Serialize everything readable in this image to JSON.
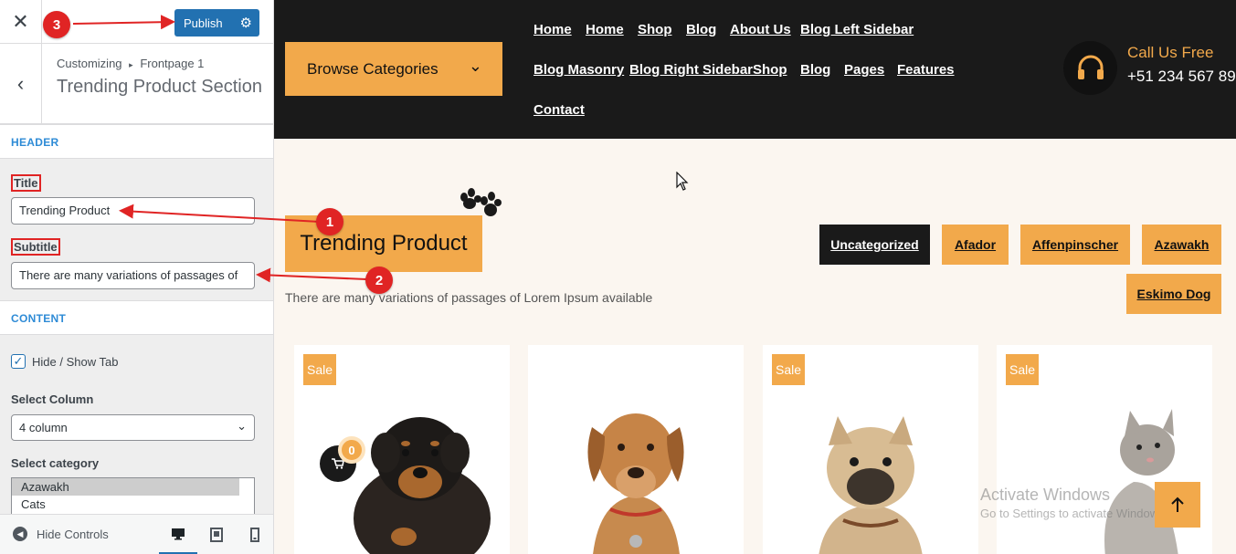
{
  "sidebar": {
    "publish_label": "Publish",
    "breadcrumb_root": "Customizing",
    "breadcrumb_sep": "▸",
    "breadcrumb_leaf": "Frontpage 1",
    "section_title": "Trending Product Section",
    "header_group": "HEADER",
    "title_label": "Title",
    "title_value": "Trending Product",
    "subtitle_label": "Subtitle",
    "subtitle_value": "There are many variations of passages of",
    "content_group": "CONTENT",
    "hide_show_tab": "Hide / Show Tab",
    "select_column_label": "Select Column",
    "select_column_value": "4 column",
    "select_category_label": "Select category",
    "category_options": [
      "Azawakh",
      "Cats"
    ],
    "hide_controls": "Hide Controls"
  },
  "preview": {
    "browse_categories": "Browse Categories",
    "nav": [
      "Home",
      "Home",
      "Shop",
      "Blog",
      "About Us",
      "Blog Left Sidebar",
      "Blog Masonry",
      "Blog Right Sidebar",
      "Shop",
      "Blog",
      "Pages",
      "Features",
      "Contact"
    ],
    "call_label": "Call Us Free",
    "call_number": "+51 234 567 89",
    "section_title": "Trending Product",
    "section_subtitle": "There are many variations of passages of Lorem Ipsum available",
    "category_tabs": [
      "Uncategorized",
      "Afador",
      "Affenpinscher",
      "Azawakh",
      "Eskimo Dog"
    ],
    "sale_label": "Sale",
    "cart_count": "0",
    "watermark_line1": "Activate Windows",
    "watermark_line2": "Go to Settings to activate Windows."
  },
  "annotations": [
    "1",
    "2",
    "3"
  ],
  "colors": {
    "accent": "#f2a94b",
    "header_bg": "#1a1a1a",
    "publish": "#2271b1",
    "annotation": "#e02424"
  }
}
